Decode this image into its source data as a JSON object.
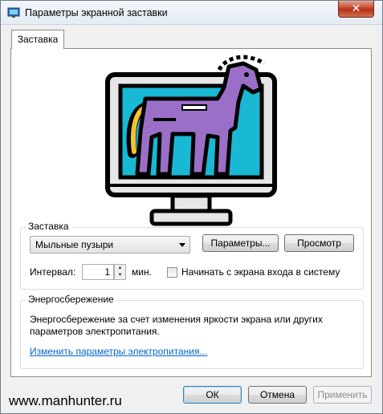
{
  "window": {
    "title": "Параметры экранной заставки",
    "close_label": "✕"
  },
  "tabs": [
    {
      "label": "Заставка",
      "active": true
    }
  ],
  "screensaver": {
    "group_label": "Заставка",
    "selected": "Мыльные пузыри",
    "settings_button": "Параметры...",
    "preview_button": "Просмотр",
    "interval_label": "Интервал:",
    "interval_value": "1",
    "interval_unit": "мин.",
    "logon_checkbox_label": "Начинать с экрана входа в систему",
    "logon_checked": false
  },
  "power": {
    "group_label": "Энергосбережение",
    "description_line1": "Энергосбережение за счет изменения яркости экрана или других",
    "description_line2": "параметров электропитания.",
    "link": "Изменить параметры электропитания..."
  },
  "footer": {
    "ok": "ОК",
    "cancel": "Отмена",
    "apply": "Применить",
    "watermark": "www.manhunter.ru"
  },
  "colors": {
    "monitor_frame": "#000000",
    "monitor_body": "#e6e6e6",
    "screen": "#19b8d4",
    "horse": "#9b6fc7",
    "tail": "#f5c233",
    "link": "#0066cc"
  },
  "icons": {
    "app": "monitor-icon",
    "preview": "trojan-horse-monitor-icon"
  }
}
